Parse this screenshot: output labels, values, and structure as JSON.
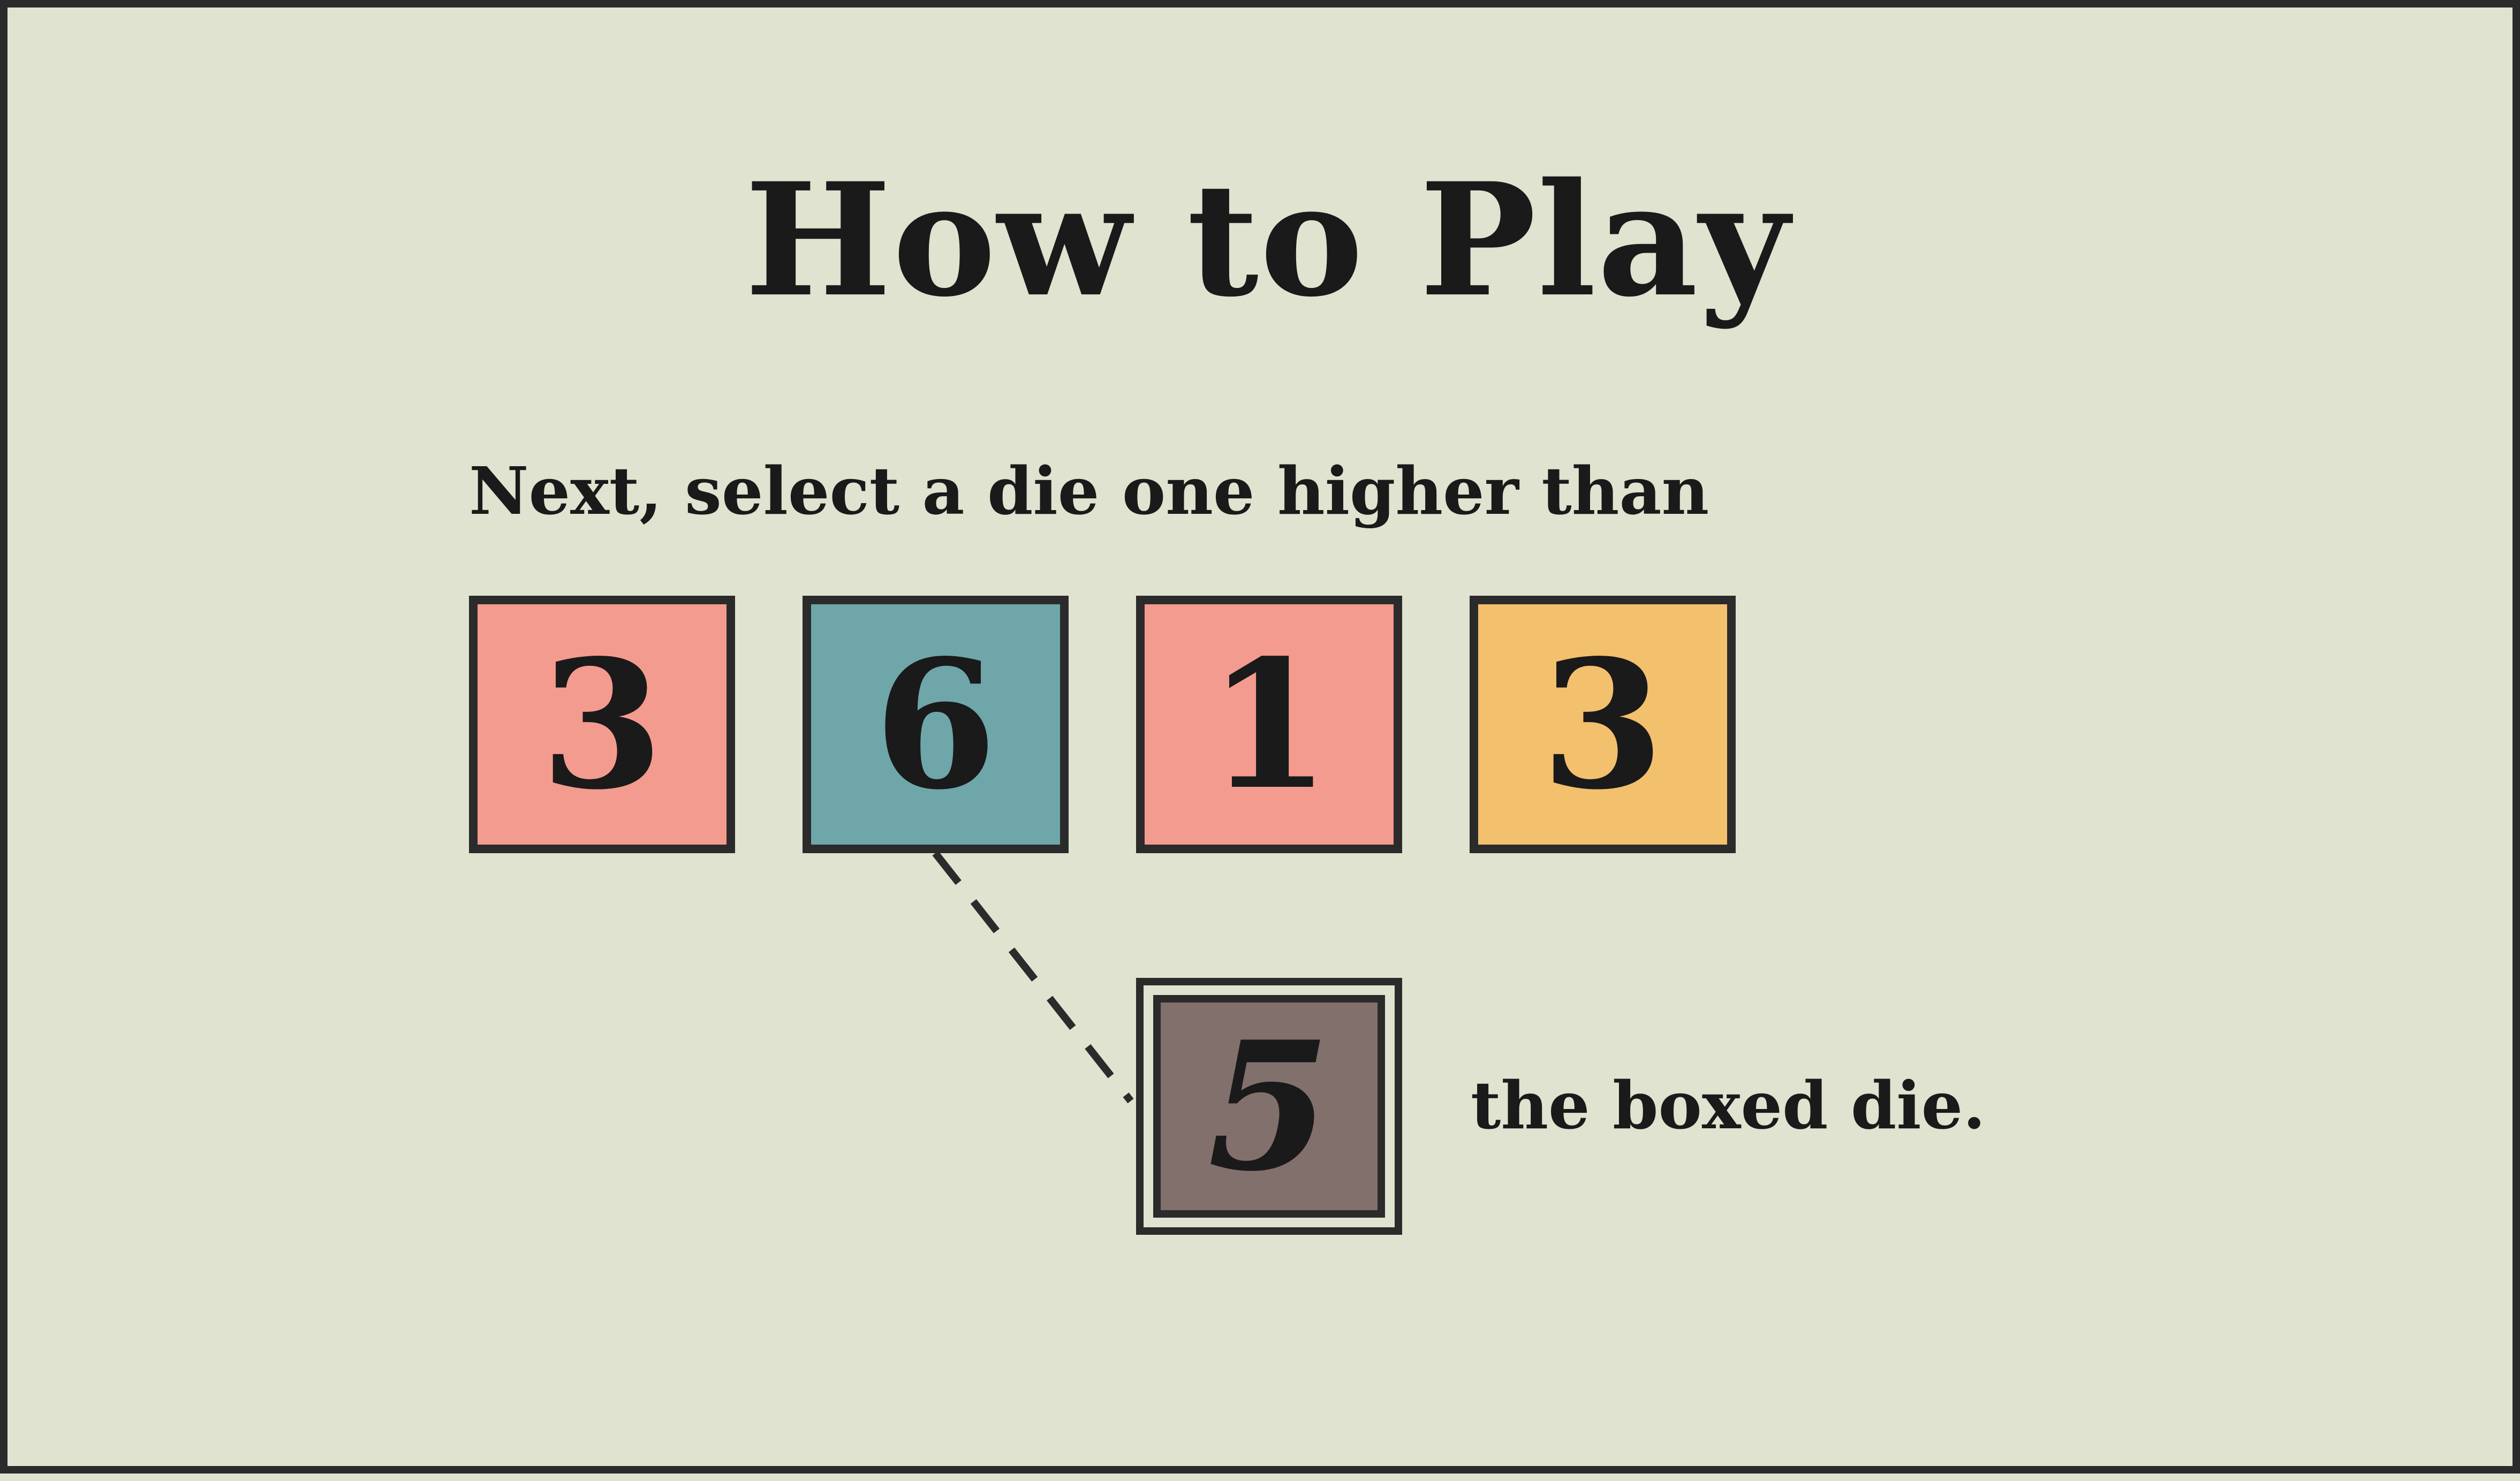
{
  "title": "How to Play",
  "instruction": {
    "prefix": "Next, select a die one higher than",
    "suffix": "the boxed die."
  },
  "dice": [
    {
      "value": "3",
      "color": "#f49b8f"
    },
    {
      "value": "6",
      "color": "#6ea6aa"
    },
    {
      "value": "1",
      "color": "#f49b8f"
    },
    {
      "value": "3",
      "color": "#f3c06e"
    }
  ],
  "boxed_die": {
    "value": "5",
    "color": "#82706d"
  },
  "colors": {
    "background": "#dfe3cf",
    "border": "#2b2b2b",
    "text": "#1a1a1a"
  }
}
